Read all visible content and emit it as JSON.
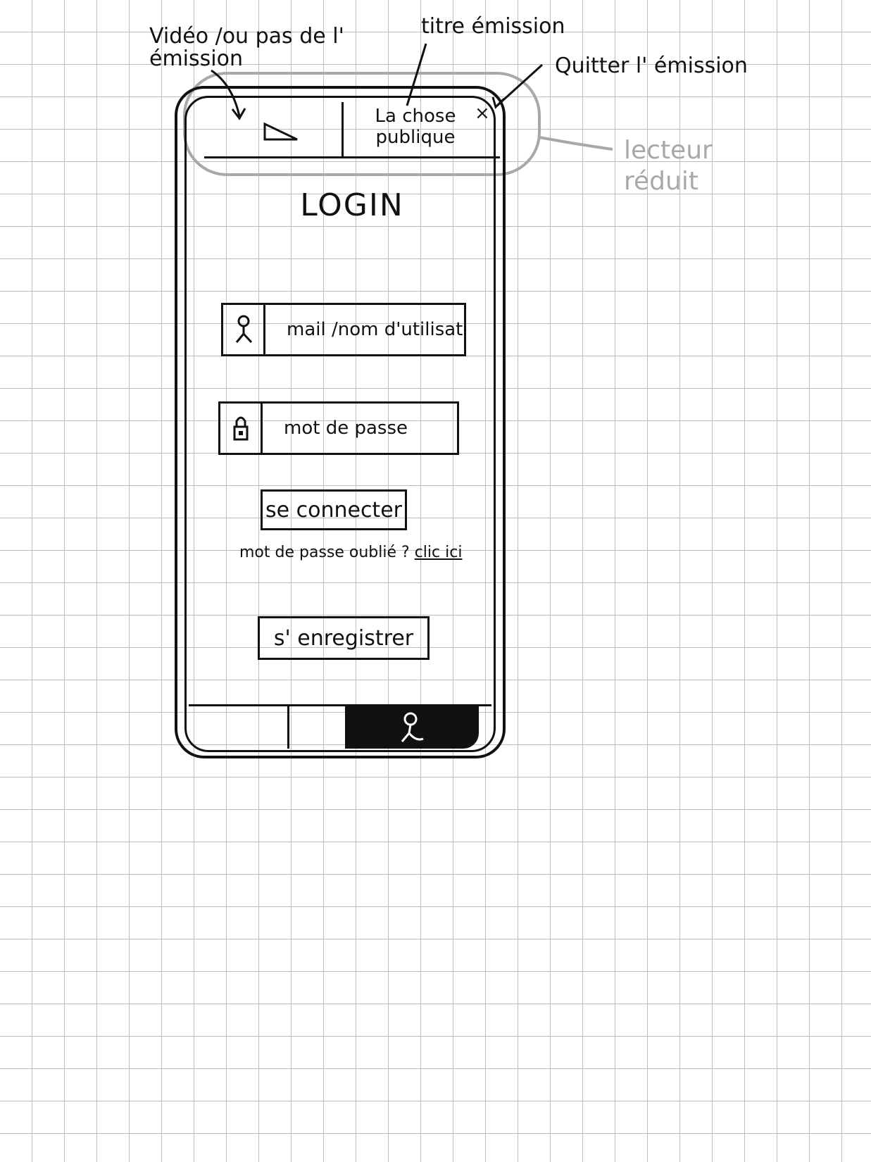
{
  "annotations": {
    "video_label": "Vidéo /ou pas de l' émission",
    "title_label": "titre émission",
    "quit_label": "Quitter l' émission",
    "reduced_player_label": "lecteur réduit"
  },
  "mini_player": {
    "title": "La chose publique",
    "play_icon": "play-icon",
    "close_icon": "close-icon"
  },
  "login": {
    "title": "LOGIN",
    "username_placeholder": "mail /nom d'utilisateu",
    "password_placeholder": "mot de passe",
    "connect_label": "se connecter",
    "forgot_text": "mot de passe oublié ?",
    "forgot_link": "clic ici",
    "register_label": "s' enregistrer"
  },
  "tab_bar": {
    "active_tab_icon": "user-icon"
  },
  "colors": {
    "ink": "#111111",
    "annotation_grey": "#a8a8a8",
    "grid": "#bdbdbd"
  }
}
